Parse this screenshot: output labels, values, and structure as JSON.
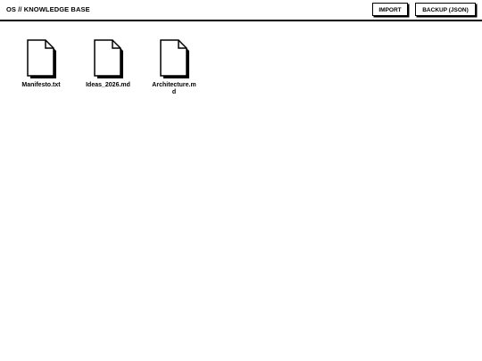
{
  "header": {
    "title": "OS // KNOWLEDGE BASE",
    "import_label": "IMPORT",
    "backup_label": "BACKUP (JSON)"
  },
  "files": [
    {
      "name": "Manifesto.txt",
      "icon": "file-icon"
    },
    {
      "name": "Ideas_2026.md",
      "icon": "file-icon"
    },
    {
      "name": "Architecture.md",
      "icon": "file-icon"
    }
  ]
}
